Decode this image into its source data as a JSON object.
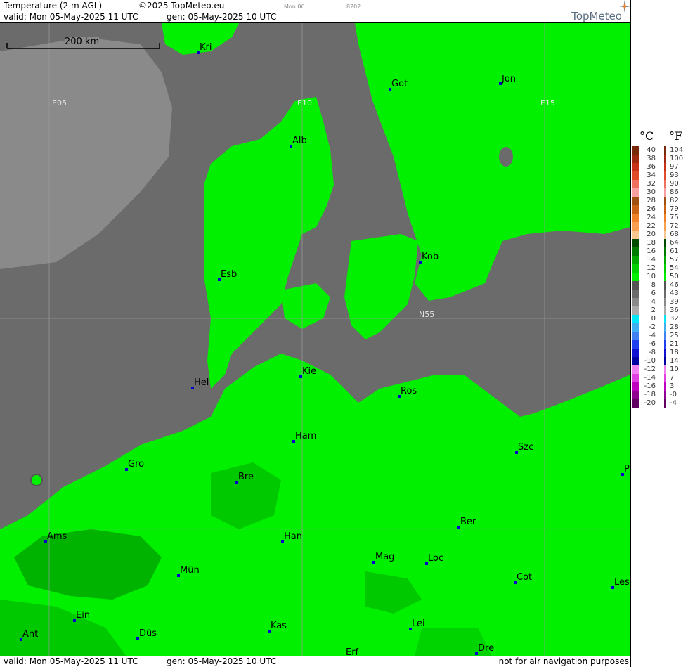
{
  "header": {
    "title": "Temperature (2 m AGL)",
    "copyright": "©2025 TopMeteo.eu",
    "run_tag": "Mon 06",
    "code": "8202",
    "valid": "valid:  Mon  05-May-2025  11 UTC",
    "generated": "gen: 05-May-2025 10 UTC",
    "logo": "TopMeteo"
  },
  "footer": {
    "valid": "valid:  Mon  05-May-2025  11 UTC",
    "generated": "gen: 05-May-2025 10 UTC",
    "disclaimer": "not for air navigation purposes"
  },
  "scale_bar": "200 km",
  "grid_labels": [
    "E05",
    "E10",
    "E15",
    "N55"
  ],
  "cities": [
    "Kri",
    "Got",
    "Jon",
    "Alb",
    "Esb",
    "Kob",
    "Kie",
    "Hel",
    "Ros",
    "Ham",
    "Szc",
    "Gro",
    "Bre",
    "P",
    "Ber",
    "Ams",
    "Han",
    "Mag",
    "Loc",
    "Mün",
    "Cot",
    "Les",
    "Ein",
    "Kas",
    "Lei",
    "Ant",
    "Düs",
    "Dre",
    "Erf"
  ],
  "legend": {
    "celsius_header": "°C",
    "fahrenheit_header": "°F",
    "celsius": [
      {
        "v": "40",
        "c": "#7a2a0a"
      },
      {
        "v": "38",
        "c": "#a02a10"
      },
      {
        "v": "36",
        "c": "#c83218"
      },
      {
        "v": "34",
        "c": "#e04a28"
      },
      {
        "v": "32",
        "c": "#f07060"
      },
      {
        "v": "30",
        "c": "#f8a0a0"
      },
      {
        "v": "28",
        "c": "#a05010"
      },
      {
        "v": "26",
        "c": "#c86414"
      },
      {
        "v": "24",
        "c": "#f08228"
      },
      {
        "v": "22",
        "c": "#f8a050"
      },
      {
        "v": "20",
        "c": "#f8c890"
      },
      {
        "v": "18",
        "c": "#004a00"
      },
      {
        "v": "16",
        "c": "#007a00"
      },
      {
        "v": "14",
        "c": "#00a800"
      },
      {
        "v": "12",
        "c": "#00d000"
      },
      {
        "v": "10",
        "c": "#00f000"
      },
      {
        "v": "8",
        "c": "#555555"
      },
      {
        "v": "6",
        "c": "#6b6b6b"
      },
      {
        "v": "4",
        "c": "#8a8a8a"
      },
      {
        "v": "2",
        "c": "#aaaaaa"
      },
      {
        "v": "0",
        "c": "#00e8f8"
      },
      {
        "v": "-2",
        "c": "#40b0f0"
      },
      {
        "v": "-4",
        "c": "#4080f0"
      },
      {
        "v": "-6",
        "c": "#2040f0"
      },
      {
        "v": "-8",
        "c": "#1010d0"
      },
      {
        "v": "-10",
        "c": "#0000a0"
      },
      {
        "v": "-12",
        "c": "#f080f0"
      },
      {
        "v": "-14",
        "c": "#e040e0"
      },
      {
        "v": "-16",
        "c": "#c000c0"
      },
      {
        "v": "-18",
        "c": "#900090"
      },
      {
        "v": "-20",
        "c": "#600060"
      }
    ],
    "fahrenheit": [
      "104",
      "100",
      "97",
      "93",
      "90",
      "86",
      "82",
      "79",
      "75",
      "72",
      "68",
      "64",
      "61",
      "57",
      "54",
      "50",
      "46",
      "43",
      "39",
      "36",
      "32",
      "28",
      "25",
      "21",
      "18",
      "14",
      "10",
      "7",
      "3",
      "-0",
      "-4"
    ]
  },
  "colors": {
    "sea": "#6b6b6b",
    "light_sea": "#8a8a8a",
    "land_bright": "#00f000",
    "land_mid": "#00d000",
    "land_dark": "#00a800",
    "city_dot": "#0000cc"
  }
}
